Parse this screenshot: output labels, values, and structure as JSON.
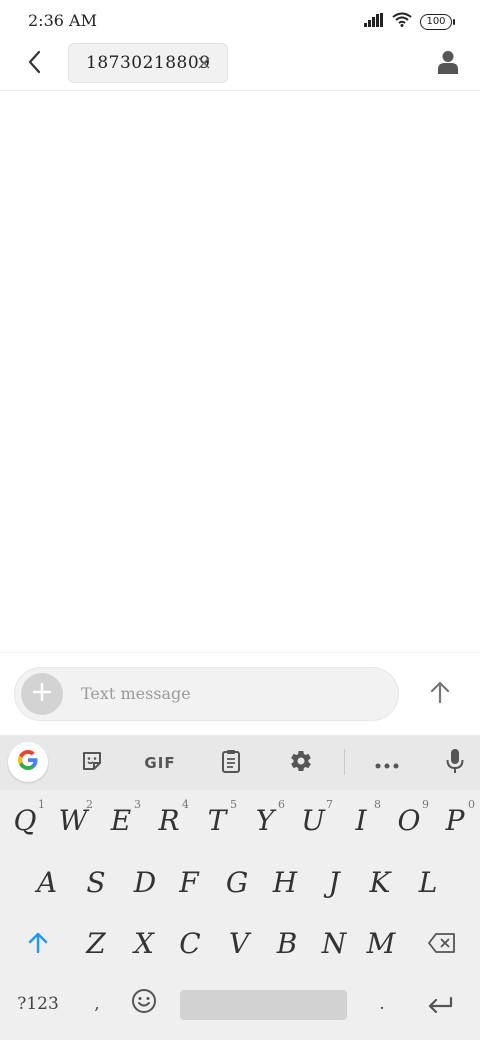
{
  "status_bar": {
    "time": "2:36 AM",
    "battery": "100"
  },
  "header": {
    "recipient": "18730218809"
  },
  "compose": {
    "placeholder": "Text message"
  },
  "keyboard": {
    "toolbar": {
      "gif_label": "GIF"
    },
    "row1": [
      {
        "key": "Q",
        "hint": "1"
      },
      {
        "key": "W",
        "hint": "2"
      },
      {
        "key": "E",
        "hint": "3"
      },
      {
        "key": "R",
        "hint": "4"
      },
      {
        "key": "T",
        "hint": "5"
      },
      {
        "key": "Y",
        "hint": "6"
      },
      {
        "key": "U",
        "hint": "7"
      },
      {
        "key": "I",
        "hint": "8"
      },
      {
        "key": "O",
        "hint": "9"
      },
      {
        "key": "P",
        "hint": "0"
      }
    ],
    "row2": [
      "A",
      "S",
      "D",
      "F",
      "G",
      "H",
      "J",
      "K",
      "L"
    ],
    "row3": [
      "Z",
      "X",
      "C",
      "V",
      "B",
      "N",
      "M"
    ],
    "bottom": {
      "symbols": "?123",
      "comma": ",",
      "period": "."
    }
  }
}
